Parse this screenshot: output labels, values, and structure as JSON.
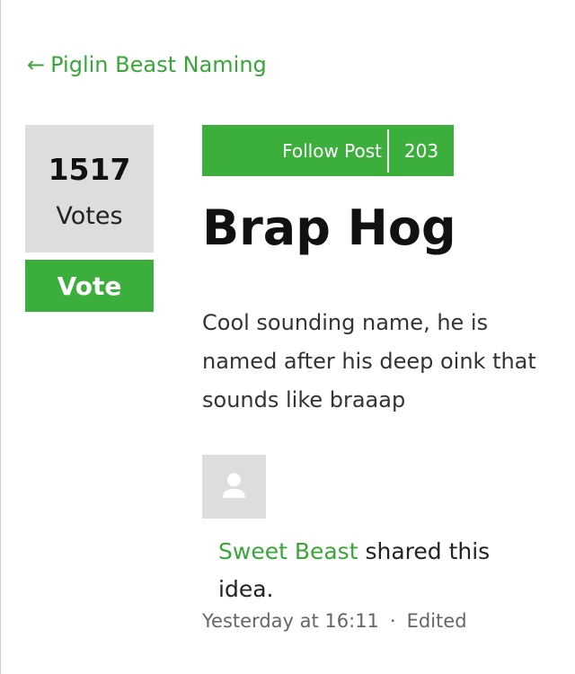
{
  "nav": {
    "back_arrow": "←",
    "back_label": "Piglin Beast Naming"
  },
  "vote": {
    "count": "1517",
    "count_label": "Votes",
    "button_label": "Vote"
  },
  "follow": {
    "label": "Follow Post",
    "count": "203"
  },
  "post": {
    "title": "Brap Hog",
    "body": "Cool sounding name, he is named after his deep oink that sounds like braaap"
  },
  "author": {
    "avatar_icon": "user-placeholder-icon",
    "name": "Sweet Beast",
    "shared_text": " shared this idea."
  },
  "meta": {
    "timestamp": "Yesterday at 16:11",
    "separator": "·",
    "edited_label": "Edited"
  },
  "colors": {
    "accent": "#3cae3c",
    "link": "#3aa63a",
    "panel": "#dddddd"
  }
}
